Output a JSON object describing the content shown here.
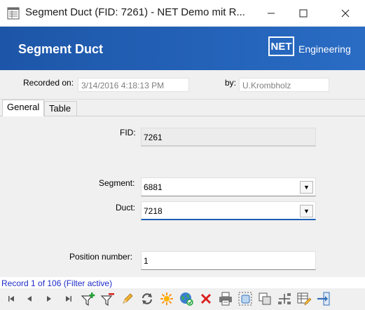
{
  "window": {
    "title": "Segment Duct (FID: 7261) - NET Demo mit R...",
    "min_glyph": "─",
    "max_glyph": "☐",
    "close_glyph": "✕"
  },
  "banner": {
    "title": "Segment Duct",
    "logo_text": "NET",
    "logo_suffix": "Engineering"
  },
  "record": {
    "recorded_on_label": "Recorded on:",
    "recorded_on_value": "3/14/2016 4:18:13 PM",
    "by_label": "by:",
    "by_value": "U.Krombholz"
  },
  "tabs": [
    {
      "label": "General",
      "active": true
    },
    {
      "label": "Table",
      "active": false
    }
  ],
  "form": {
    "fid_label": "FID:",
    "fid_value": "7261",
    "segment_label": "Segment:",
    "segment_value": "6881",
    "duct_label": "Duct:",
    "duct_value": "7218",
    "position_label": "Position number:",
    "position_value": "1",
    "dropdown_glyph": "▼"
  },
  "status": {
    "text": "Record 1 of 106 (Filter active)"
  },
  "toolbar": {
    "icons": [
      "first-record-icon",
      "previous-record-icon",
      "next-record-icon",
      "last-record-icon",
      "add-filter-icon",
      "remove-filter-icon",
      "edit-icon",
      "refresh-icon",
      "highlight-icon",
      "globe-locate-icon",
      "delete-icon",
      "print-icon",
      "select-object-icon",
      "copy-icon",
      "connect-icon",
      "table-edit-icon",
      "exit-icon"
    ]
  },
  "colors": {
    "banner": "#2463b9",
    "status_text": "#1e2bc8",
    "focus_underline": "#1d5fb4",
    "delete_red": "#d9201f",
    "add_green": "#21a136"
  }
}
